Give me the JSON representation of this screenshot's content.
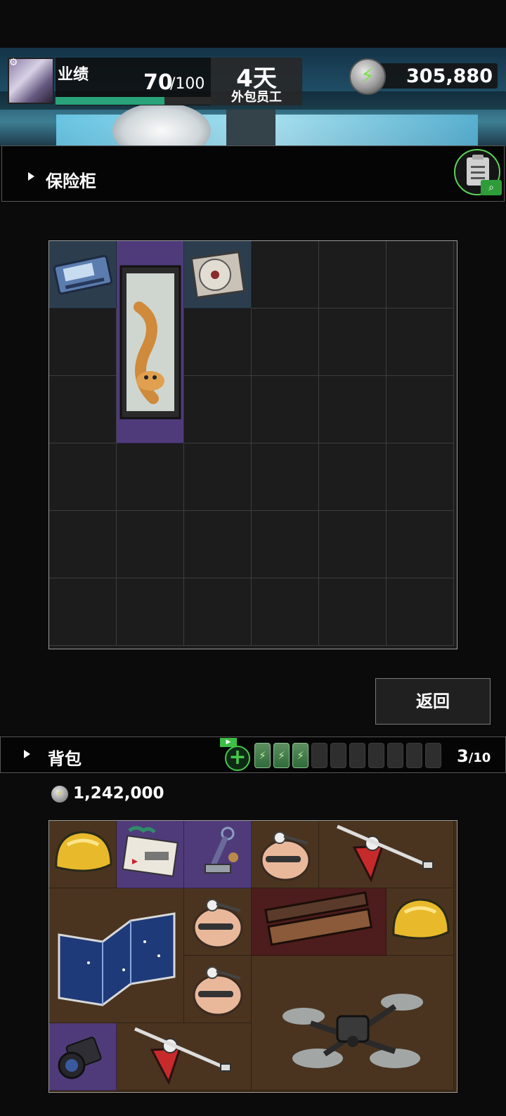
{
  "hud": {
    "performance_label": "业绩",
    "performance_value": "70",
    "performance_max": "/100",
    "performance_fraction": 0.7,
    "days_value": "4天",
    "days_label": "外包员工",
    "energy_value": "305,880"
  },
  "safe": {
    "title": "保险柜",
    "back_label": "返回",
    "grid": {
      "cols": 6,
      "rows": 6
    },
    "items": [
      {
        "name": "hard-drive",
        "col": 0,
        "row": 0,
        "w": 1,
        "h": 1,
        "rarity": "blue"
      },
      {
        "name": "tiger-scroll-painting",
        "col": 1,
        "row": 0,
        "w": 1,
        "h": 3,
        "rarity": "purple"
      },
      {
        "name": "cd-disc",
        "col": 2,
        "row": 0,
        "w": 1,
        "h": 1,
        "rarity": "blue"
      }
    ]
  },
  "backpack": {
    "title": "背包",
    "capacity_used": "3",
    "capacity_total": "/10",
    "batteries_filled": 3,
    "batteries_total": 10,
    "money": "1,242,000",
    "grid": {
      "cols": 6,
      "rows": 4
    },
    "items": [
      {
        "name": "gold-nugget",
        "col": 0,
        "row": 0,
        "w": 1,
        "h": 1,
        "rarity": "brown"
      },
      {
        "name": "postcard",
        "col": 1,
        "row": 0,
        "w": 1,
        "h": 1,
        "rarity": "purple"
      },
      {
        "name": "figurine-keychain",
        "col": 2,
        "row": 0,
        "w": 1,
        "h": 1,
        "rarity": "purple"
      },
      {
        "name": "egg-toy",
        "col": 3,
        "row": 0,
        "w": 1,
        "h": 1,
        "rarity": "brown"
      },
      {
        "name": "red-spinning-top",
        "col": 4,
        "row": 0,
        "w": 2,
        "h": 1,
        "rarity": "brown"
      },
      {
        "name": "star-map",
        "col": 0,
        "row": 1,
        "w": 2,
        "h": 2,
        "rarity": "brown"
      },
      {
        "name": "egg-toy",
        "col": 2,
        "row": 1,
        "w": 1,
        "h": 1,
        "rarity": "brown"
      },
      {
        "name": "wooden-box",
        "col": 3,
        "row": 1,
        "w": 2,
        "h": 1,
        "rarity": "red"
      },
      {
        "name": "gold-nugget",
        "col": 5,
        "row": 1,
        "w": 1,
        "h": 1,
        "rarity": "brown"
      },
      {
        "name": "egg-toy",
        "col": 2,
        "row": 2,
        "w": 1,
        "h": 1,
        "rarity": "brown"
      },
      {
        "name": "drone",
        "col": 3,
        "row": 2,
        "w": 3,
        "h": 2,
        "rarity": "brown"
      },
      {
        "name": "camera-lens",
        "col": 0,
        "row": 3,
        "w": 1,
        "h": 1,
        "rarity": "purple"
      },
      {
        "name": "red-spinning-top",
        "col": 1,
        "row": 3,
        "w": 2,
        "h": 1,
        "rarity": "brown"
      }
    ]
  },
  "colors": {
    "accent_green": "#2aa37a",
    "rarity_blue": "#2c3e4e",
    "rarity_purple": "#4f3b7a",
    "rarity_red": "#4d1c1c",
    "rarity_brown": "#4a3420"
  }
}
